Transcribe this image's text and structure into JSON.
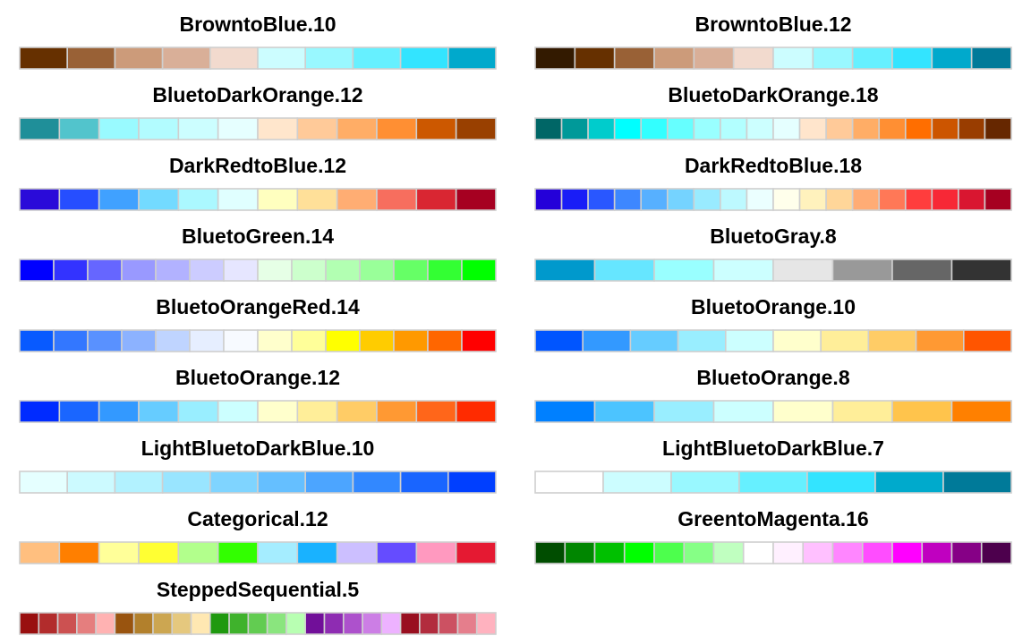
{
  "chart_data": [
    {
      "type": "table",
      "title": "BrowntoBlue.10",
      "colors": [
        "#663000",
        "#996136",
        "#CC9B7A",
        "#D9AF98",
        "#F2DACE",
        "#CCFDFF",
        "#99F8FF",
        "#66F0FF",
        "#33E4FF",
        "#00A9CC"
      ]
    },
    {
      "type": "table",
      "title": "BrowntoBlue.12",
      "colors": [
        "#331A00",
        "#663000",
        "#996136",
        "#CC9B7A",
        "#D9AF98",
        "#F2DACE",
        "#CCFDFF",
        "#99F8FF",
        "#66F0FF",
        "#33E4FF",
        "#00A9CC",
        "#007A99"
      ]
    },
    {
      "type": "table",
      "title": "BluetoDarkOrange.12",
      "colors": [
        "#1F8F99",
        "#52C4CC",
        "#99FAFF",
        "#B2FCFF",
        "#CCFEFF",
        "#E6FFFF",
        "#FFE6CC",
        "#FFCA99",
        "#FFAD66",
        "#FF8F33",
        "#CC5800",
        "#994000"
      ]
    },
    {
      "type": "table",
      "title": "BluetoDarkOrange.18",
      "colors": [
        "#006666",
        "#009999",
        "#00CCCC",
        "#00FFFF",
        "#33FFFF",
        "#66FFFF",
        "#99FFFF",
        "#B2FFFF",
        "#CCFFFF",
        "#E5FFFF",
        "#FFE5CC",
        "#FFCA99",
        "#FFAD66",
        "#FF8F33",
        "#FF6E00",
        "#CC5500",
        "#993D00",
        "#662700"
      ]
    },
    {
      "type": "table",
      "title": "DarkRedtoBlue.12",
      "colors": [
        "#2A0BD9",
        "#264EFF",
        "#40A1FF",
        "#73DAFF",
        "#ABF8FF",
        "#E0FFFF",
        "#FFFFBF",
        "#FFE099",
        "#FFAD73",
        "#F76E5E",
        "#D92632",
        "#A60021"
      ]
    },
    {
      "type": "table",
      "title": "DarkRedtoBlue.18",
      "colors": [
        "#2400D9",
        "#191DF7",
        "#2957FF",
        "#3D87FF",
        "#57B0FF",
        "#75D3FF",
        "#99EBFF",
        "#BDF9FF",
        "#EBFFFF",
        "#FFFFEB",
        "#FFF2BD",
        "#FFD699",
        "#FFAC75",
        "#FF7857",
        "#FF3D3D",
        "#F72836",
        "#D91630",
        "#A60021"
      ]
    },
    {
      "type": "table",
      "title": "BluetoGreen.14",
      "colors": [
        "#0000FF",
        "#3333FF",
        "#6666FF",
        "#9999FF",
        "#B2B2FF",
        "#CCCCFF",
        "#E6E6FF",
        "#E6FFE6",
        "#CCFFCC",
        "#B2FFB2",
        "#99FF99",
        "#66FF66",
        "#33FF33",
        "#00FF00"
      ]
    },
    {
      "type": "table",
      "title": "BluetoGray.8",
      "colors": [
        "#0099CC",
        "#66E6FF",
        "#99FFFF",
        "#CCFFFF",
        "#E6E6E6",
        "#999999",
        "#666666",
        "#333333"
      ]
    },
    {
      "type": "table",
      "title": "BluetoOrangeRed.14",
      "colors": [
        "#085AFF",
        "#3377FF",
        "#5991FF",
        "#8CB2FF",
        "#BFD4FF",
        "#E6EEFF",
        "#F7FAFF",
        "#FFFFCC",
        "#FFFF99",
        "#FFFF00",
        "#FFCC00",
        "#FF9900",
        "#FF6600",
        "#FF0000"
      ]
    },
    {
      "type": "table",
      "title": "BluetoOrange.10",
      "colors": [
        "#0055FF",
        "#3399FF",
        "#66CCFF",
        "#99EEFF",
        "#CCFFFF",
        "#FFFFCC",
        "#FFEE99",
        "#FFCC66",
        "#FF9933",
        "#FF5500"
      ]
    },
    {
      "type": "table",
      "title": "BluetoOrange.12",
      "colors": [
        "#002BFF",
        "#1A66FF",
        "#3399FF",
        "#66CCFF",
        "#99EEFF",
        "#CCFFFF",
        "#FFFFCC",
        "#FFEE99",
        "#FFCC66",
        "#FF9933",
        "#FF661A",
        "#FF2B00"
      ]
    },
    {
      "type": "table",
      "title": "BluetoOrange.8",
      "colors": [
        "#0080FF",
        "#4CC4FF",
        "#99EEFF",
        "#CCFFFF",
        "#FFFFCC",
        "#FFEE99",
        "#FFC44C",
        "#FF8000"
      ]
    },
    {
      "type": "table",
      "title": "LightBluetoDarkBlue.10",
      "colors": [
        "#E5FFFF",
        "#CCFAFF",
        "#B2F2FF",
        "#99E5FF",
        "#7FD4FF",
        "#65BFFF",
        "#4CA5FF",
        "#3288FF",
        "#1965FF",
        "#003FFF"
      ]
    },
    {
      "type": "table",
      "title": "LightBluetoDarkBlue.7",
      "colors": [
        "#FFFFFF",
        "#CCFDFF",
        "#99F8FF",
        "#66F0FF",
        "#33E4FF",
        "#00AACC",
        "#007A99"
      ]
    },
    {
      "type": "table",
      "title": "Categorical.12",
      "colors": [
        "#FFBF7F",
        "#FF7F00",
        "#FFFF99",
        "#FFFF33",
        "#B2FF8C",
        "#32FF00",
        "#A5EDFF",
        "#19B2FF",
        "#CCBFFF",
        "#654CFF",
        "#FF99BF",
        "#E51932"
      ]
    },
    {
      "type": "table",
      "title": "GreentoMagenta.16",
      "colors": [
        "#004D00",
        "#008600",
        "#00C000",
        "#00FF00",
        "#4DFF4D",
        "#86FF86",
        "#C0FFC0",
        "#FFFFFF",
        "#FFF0FF",
        "#FFC0FF",
        "#FF86FF",
        "#FF4DFF",
        "#FF00FF",
        "#C000C0",
        "#860086",
        "#4D004D"
      ]
    },
    {
      "type": "table",
      "title": "SteppedSequential.5",
      "colors": [
        "#990F0F",
        "#B22C2C",
        "#CC5151",
        "#E57E7E",
        "#FFB2B2",
        "#99540F",
        "#B2802C",
        "#CCA651",
        "#E5C87E",
        "#FFE8B2",
        "#1F990F",
        "#3FB22C",
        "#62CC51",
        "#8AE57E",
        "#B8FFB2",
        "#710F99",
        "#8E2CB2",
        "#AD51CC",
        "#CC7EE5",
        "#EDB2FF",
        "#990F20",
        "#B22C3E",
        "#CC5162",
        "#E57E8C",
        "#FFB2BF"
      ]
    }
  ]
}
